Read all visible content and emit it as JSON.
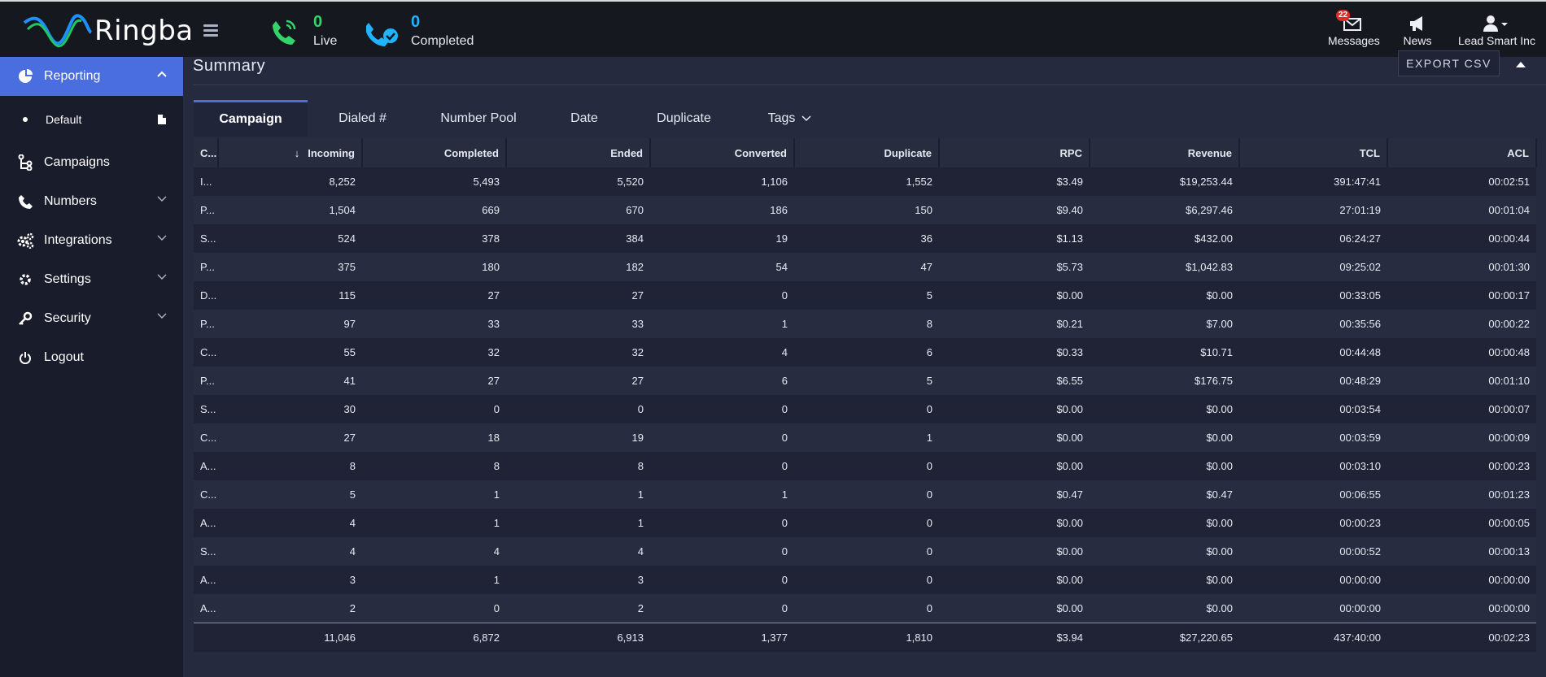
{
  "app": {
    "brand": "Ringba",
    "live": {
      "count": "0",
      "label": "Live"
    },
    "completed": {
      "count": "0",
      "label": "Completed"
    },
    "messages": {
      "label": "Messages",
      "badge": "22"
    },
    "news": {
      "label": "News"
    },
    "user": {
      "label": "Lead Smart Inc"
    }
  },
  "colors": {
    "accent": "#4a6ee0",
    "live": "#33d46a",
    "completed": "#1fb4ff",
    "badge": "#e02b2b"
  },
  "sidebar": {
    "reporting": "Reporting",
    "default_report": "Default",
    "items": [
      {
        "label": "Campaigns",
        "icon": "campaigns-icon"
      },
      {
        "label": "Numbers",
        "icon": "phone-icon"
      },
      {
        "label": "Integrations",
        "icon": "gears-icon"
      },
      {
        "label": "Settings",
        "icon": "gear-icon"
      },
      {
        "label": "Security",
        "icon": "key-icon"
      },
      {
        "label": "Logout",
        "icon": "power-icon"
      }
    ]
  },
  "summary": {
    "title": "Summary",
    "export_label": "EXPORT CSV",
    "tabs": [
      "Campaign",
      "Dialed #",
      "Number Pool",
      "Date",
      "Duplicate",
      "Tags"
    ],
    "active_tab": "Campaign",
    "columns": [
      "C...",
      "Incoming",
      "Completed",
      "Ended",
      "Converted",
      "Duplicate",
      "RPC",
      "Revenue",
      "TCL",
      "ACL"
    ],
    "rows": [
      [
        "I...",
        "8,252",
        "5,493",
        "5,520",
        "1,106",
        "1,552",
        "$3.49",
        "$19,253.44",
        "391:47:41",
        "00:02:51"
      ],
      [
        "P...",
        "1,504",
        "669",
        "670",
        "186",
        "150",
        "$9.40",
        "$6,297.46",
        "27:01:19",
        "00:01:04"
      ],
      [
        "S...",
        "524",
        "378",
        "384",
        "19",
        "36",
        "$1.13",
        "$432.00",
        "06:24:27",
        "00:00:44"
      ],
      [
        "P...",
        "375",
        "180",
        "182",
        "54",
        "47",
        "$5.73",
        "$1,042.83",
        "09:25:02",
        "00:01:30"
      ],
      [
        "D...",
        "115",
        "27",
        "27",
        "0",
        "5",
        "$0.00",
        "$0.00",
        "00:33:05",
        "00:00:17"
      ],
      [
        "P...",
        "97",
        "33",
        "33",
        "1",
        "8",
        "$0.21",
        "$7.00",
        "00:35:56",
        "00:00:22"
      ],
      [
        "C...",
        "55",
        "32",
        "32",
        "4",
        "6",
        "$0.33",
        "$10.71",
        "00:44:48",
        "00:00:48"
      ],
      [
        "P...",
        "41",
        "27",
        "27",
        "6",
        "5",
        "$6.55",
        "$176.75",
        "00:48:29",
        "00:01:10"
      ],
      [
        "S...",
        "30",
        "0",
        "0",
        "0",
        "0",
        "$0.00",
        "$0.00",
        "00:03:54",
        "00:00:07"
      ],
      [
        "C...",
        "27",
        "18",
        "19",
        "0",
        "1",
        "$0.00",
        "$0.00",
        "00:03:59",
        "00:00:09"
      ],
      [
        "A...",
        "8",
        "8",
        "8",
        "0",
        "0",
        "$0.00",
        "$0.00",
        "00:03:10",
        "00:00:23"
      ],
      [
        "C...",
        "5",
        "1",
        "1",
        "1",
        "0",
        "$0.47",
        "$0.47",
        "00:06:55",
        "00:01:23"
      ],
      [
        "A...",
        "4",
        "1",
        "1",
        "0",
        "0",
        "$0.00",
        "$0.00",
        "00:00:23",
        "00:00:05"
      ],
      [
        "S...",
        "4",
        "4",
        "4",
        "0",
        "0",
        "$0.00",
        "$0.00",
        "00:00:52",
        "00:00:13"
      ],
      [
        "A...",
        "3",
        "1",
        "3",
        "0",
        "0",
        "$0.00",
        "$0.00",
        "00:00:00",
        "00:00:00"
      ],
      [
        "A...",
        "2",
        "0",
        "2",
        "0",
        "0",
        "$0.00",
        "$0.00",
        "00:00:00",
        "00:00:00"
      ]
    ],
    "totals": [
      "",
      "11,046",
      "6,872",
      "6,913",
      "1,377",
      "1,810",
      "$3.94",
      "$27,220.65",
      "437:40:00",
      "00:02:23"
    ]
  }
}
